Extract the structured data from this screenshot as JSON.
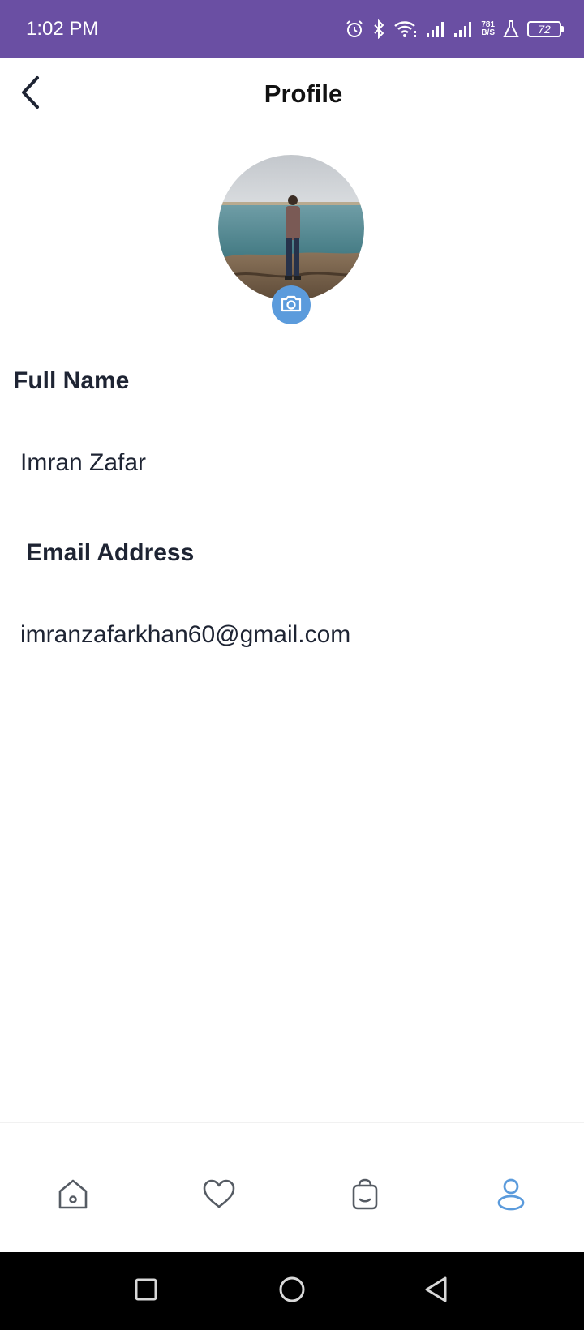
{
  "colors": {
    "status_bar": "#6a4fa3",
    "accent": "#5b9bdc",
    "text_dark": "#1e2433",
    "icon_gray": "#555b63"
  },
  "status_bar": {
    "time": "1:02 PM",
    "icons": [
      "alarm-icon",
      "bluetooth-icon",
      "wifi-icon",
      "signal-icon",
      "signal-icon",
      "lab-icon"
    ],
    "net_speed_value": "781",
    "net_speed_unit": "B/S",
    "battery_level": "72"
  },
  "header": {
    "title": "Profile",
    "back_icon": "chevron-left-icon"
  },
  "profile": {
    "camera_icon": "camera-icon"
  },
  "form": {
    "full_name_label": "Full Name",
    "full_name_value": "Imran Zafar",
    "email_label": "Email Address",
    "email_value": "imranzafarkhan60@gmail.com"
  },
  "bottom_nav": {
    "items": [
      {
        "icon": "home-icon",
        "active": false
      },
      {
        "icon": "heart-icon",
        "active": false
      },
      {
        "icon": "shopping-bag-icon",
        "active": false
      },
      {
        "icon": "user-icon",
        "active": true
      }
    ]
  },
  "system_nav": {
    "buttons": [
      "recents-icon",
      "home-circle-icon",
      "back-triangle-icon"
    ]
  }
}
